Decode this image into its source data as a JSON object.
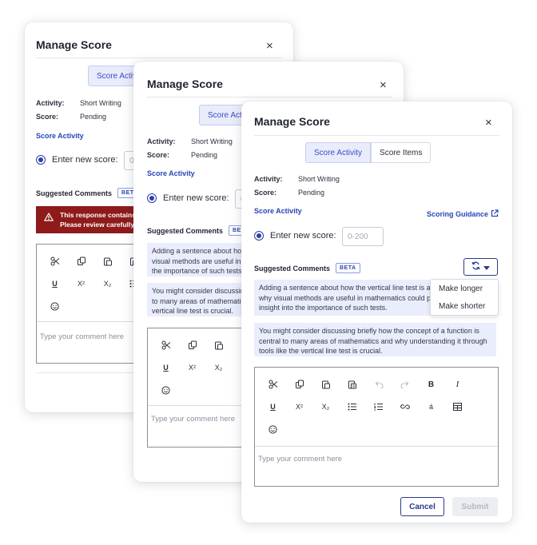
{
  "dialog": {
    "title": "Manage Score",
    "close_glyph": "×",
    "tabs": {
      "score_activity": "Score Activity",
      "score_items": "Score Items"
    },
    "activity_key": "Activity:",
    "activity_value": "Short Writing",
    "score_key": "Score:",
    "score_value": "Pending",
    "score_activity_link": "Score Activity",
    "scoring_guidance_link": "Scoring Guidance",
    "enter_new_score_label": "Enter new score:",
    "score_input_placeholder": "0-200",
    "suggested_comments_label": "Suggested Comments",
    "beta_badge": "BETA",
    "suggestions": [
      "Adding a sentence about how the vertical line test is a visual method and why visual methods are useful in mathematics could provide a deeper insight into the importance of such tests.",
      "You might consider discussing briefly how the concept of a function is central to many areas of mathematics and why understanding it through tools like the vertical line test is crucial."
    ],
    "alert_text": [
      "This response contains content that may be flagged.",
      "Please review carefully before submitting."
    ],
    "comment_placeholder": "Type your comment here",
    "regenerate_menu": [
      "Make longer",
      "Make shorter"
    ],
    "cancel_button": "Cancel",
    "submit_button": "Submit"
  },
  "toolbar_icons": [
    "scissors-icon",
    "copy-icon",
    "paste-icon",
    "paste-text-icon",
    "undo-icon",
    "redo-icon",
    "bold-icon",
    "italic-icon",
    "underline-icon",
    "superscript-icon",
    "subscript-icon",
    "bulleted-list-icon",
    "numbered-list-icon",
    "link-icon",
    "special-character-icon",
    "table-icon",
    "emoji-icon"
  ],
  "toolbar_glyphs": {
    "bold": "B",
    "italic": "I",
    "underline": "U",
    "superscript": "X²",
    "subscript": "X₂",
    "special": "á"
  },
  "colors": {
    "accent": "#2745b6",
    "tab_active_bg": "#e9ecfb",
    "suggestion_bg": "#eaedfb",
    "alert_bg": "#8e1a1a",
    "cancel_border": "#2a3a8a",
    "submit_disabled_bg": "#eceef2"
  }
}
